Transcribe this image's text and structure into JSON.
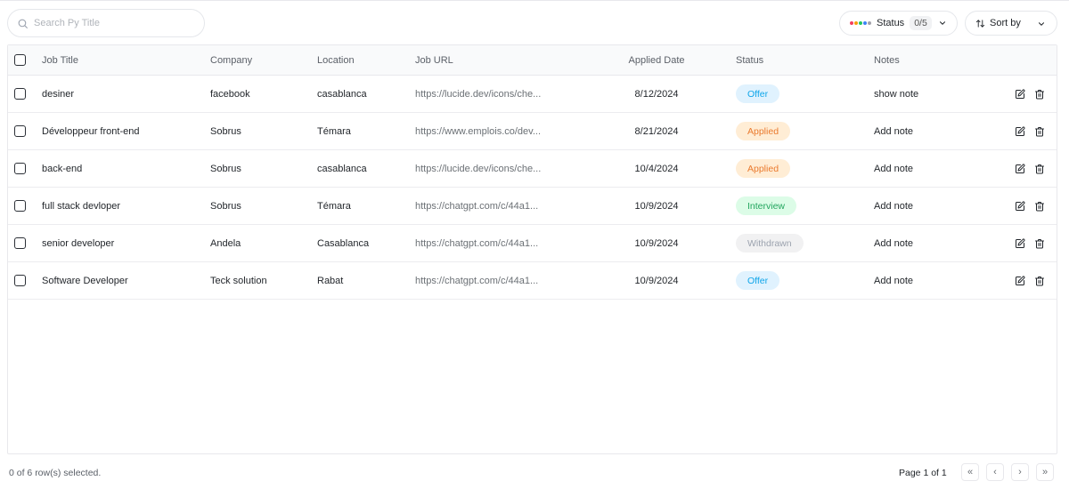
{
  "search": {
    "placeholder": "Search Py Title",
    "value": ""
  },
  "toolbar": {
    "status_label": "Status",
    "status_count": "0/5",
    "status_dot_colors": [
      "#f43f5e",
      "#f59e0b",
      "#22c55e",
      "#3b82f6",
      "#a1a1aa"
    ],
    "sort_label": "Sort by"
  },
  "table": {
    "headers": {
      "title": "Job Title",
      "company": "Company",
      "location": "Location",
      "url": "Job URL",
      "date": "Applied Date",
      "status": "Status",
      "notes": "Notes"
    },
    "rows": [
      {
        "title": "desiner",
        "company": "facebook",
        "location": "casablanca",
        "url": "https://lucide.dev/icons/che...",
        "date": "8/12/2024",
        "status": "Offer",
        "notes": "show note"
      },
      {
        "title": "Développeur front-end",
        "company": "Sobrus",
        "location": "Témara",
        "url": "https://www.emplois.co/dev...",
        "date": "8/21/2024",
        "status": "Applied",
        "notes": "Add note"
      },
      {
        "title": "back-end",
        "company": "Sobrus",
        "location": "casablanca",
        "url": "https://lucide.dev/icons/che...",
        "date": "10/4/2024",
        "status": "Applied",
        "notes": "Add note"
      },
      {
        "title": "full stack devloper",
        "company": "Sobrus",
        "location": "Témara",
        "url": "https://chatgpt.com/c/44a1...",
        "date": "10/9/2024",
        "status": "Interview",
        "notes": "Add note"
      },
      {
        "title": "senior developer",
        "company": "Andela",
        "location": "Casablanca",
        "url": "https://chatgpt.com/c/44a1...",
        "date": "10/9/2024",
        "status": "Withdrawn",
        "notes": "Add note"
      },
      {
        "title": "Software Developer",
        "company": "Teck solution",
        "location": "Rabat",
        "url": "https://chatgpt.com/c/44a1...",
        "date": "10/9/2024",
        "status": "Offer",
        "notes": "Add note"
      }
    ],
    "row_icons": [
      "edit-icon",
      "trash-icon"
    ]
  },
  "status_colors": {
    "Offer": {
      "bg": "#e0f2fe",
      "fg": "#0ea5e9"
    },
    "Applied": {
      "bg": "#ffedd5",
      "fg": "#ea7a2e"
    },
    "Interview": {
      "bg": "#dcfce7",
      "fg": "#22a55e"
    },
    "Withdrawn": {
      "bg": "#f1f1f2",
      "fg": "#9ca3af"
    }
  },
  "footer": {
    "selected": "0 of 6 row(s) selected.",
    "page": "Page 1 of 1",
    "first": "«",
    "prev": "‹",
    "next": "›",
    "last": "»"
  }
}
